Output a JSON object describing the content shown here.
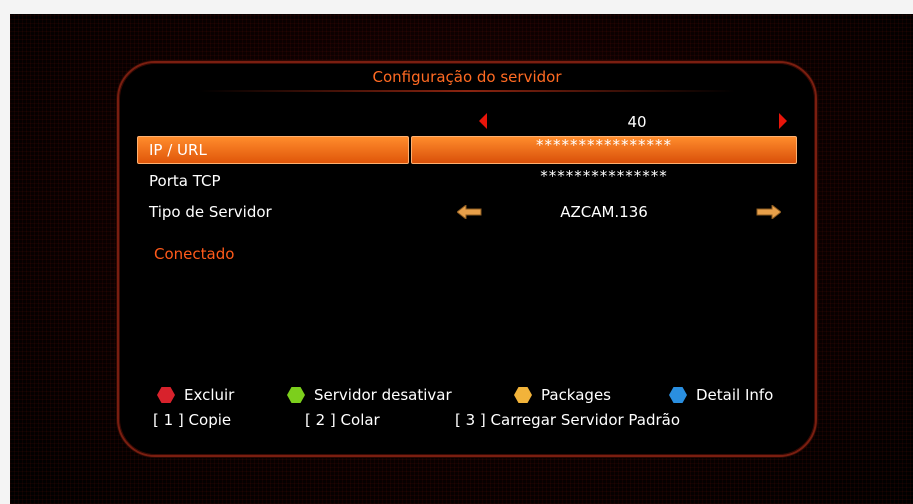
{
  "panel": {
    "title": "Configuração do servidor"
  },
  "pager": {
    "value": "40"
  },
  "rows": [
    {
      "label": "IP / URL",
      "value": "****************"
    },
    {
      "label": "Porta TCP",
      "value": "***************"
    },
    {
      "label": "Tipo de Servidor",
      "value": "AZCAM.136"
    }
  ],
  "status": "Conectado",
  "legend": [
    {
      "color": "#d8222c",
      "label": "Excluir"
    },
    {
      "color": "#7ccf1c",
      "label": "Servidor desativar"
    },
    {
      "color": "#f2b33a",
      "label": "Packages"
    },
    {
      "color": "#2a8fe0",
      "label": "Detail Info"
    }
  ],
  "shortcuts": [
    "[ 1 ] Copie",
    "[ 2 ] Colar",
    "[ 3 ] Carregar Servidor Padrão"
  ],
  "colors": {
    "accent": "#ff6a22",
    "selection": "#f07a1e",
    "arrow_red": "#e8150a",
    "arrow_orange": "#e8a04a"
  },
  "icons": {
    "pager_left": "triangle-left-icon",
    "pager_right": "triangle-right-icon",
    "type_left": "arrow-left-icon",
    "type_right": "arrow-right-icon"
  }
}
